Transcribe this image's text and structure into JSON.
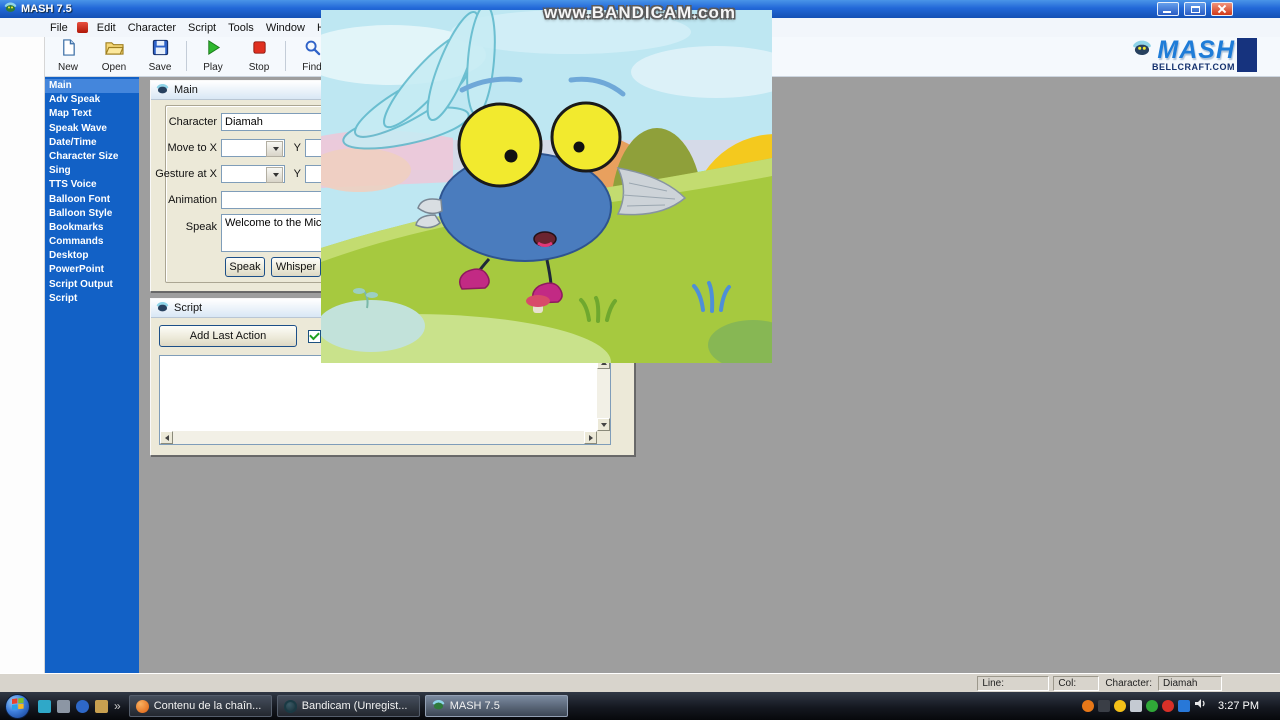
{
  "watermark": "www.BANDICAM.com",
  "title_bar": {
    "title": "MASH 7.5"
  },
  "menu": {
    "items": [
      "File",
      "Edit",
      "Character",
      "Script",
      "Tools",
      "Window",
      "Help"
    ]
  },
  "toolbar": {
    "new": "New",
    "open": "Open",
    "save": "Save",
    "play": "Play",
    "stop": "Stop",
    "find": "Find"
  },
  "logo": {
    "name": "MASH",
    "site": "BELLCRAFT.COM"
  },
  "sidebar": {
    "items": [
      "Main",
      "Adv Speak",
      "Map Text",
      "Speak Wave",
      "Date/Time",
      "Character Size",
      "Sing",
      "TTS Voice",
      "Balloon Font",
      "Balloon Style",
      "Bookmarks",
      "Commands",
      "Desktop",
      "PowerPoint",
      "Script Output",
      "Script"
    ],
    "selected": "Main"
  },
  "main_panel": {
    "title": "Main",
    "character_label": "Character",
    "character_value": "Diamah",
    "move_to_x_label": "Move to X",
    "move_y_label": "Y",
    "gesture_at_x_label": "Gesture at X",
    "gesture_y_label": "Y",
    "animation_label": "Animation",
    "speak_label": "Speak",
    "speak_value": "Welcome to the Micros",
    "speak_button": "Speak",
    "whisper_button": "Whisper"
  },
  "script_panel": {
    "title": "Script",
    "add_last_action_button": "Add Last Action"
  },
  "status_bar": {
    "line_label": "Line:",
    "col_label": "Col:",
    "character_label": "Character:",
    "character_value": "Diamah"
  },
  "taskbar": {
    "chevron": "»",
    "buttons": [
      {
        "label": "Contenu de la chaîn..."
      },
      {
        "label": "Bandicam (Unregist..."
      },
      {
        "label": "MASH 7.5"
      }
    ],
    "clock": "3:27 PM"
  }
}
